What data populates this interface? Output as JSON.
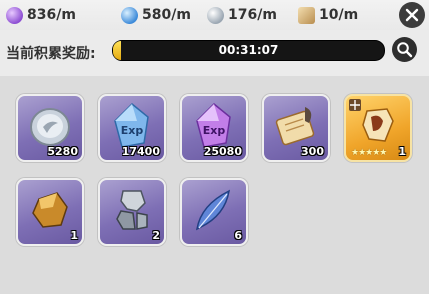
{
  "rates": [
    {
      "icon": "purple-gem-icon",
      "value": "836/m"
    },
    {
      "icon": "blue-crystal-icon",
      "value": "580/m"
    },
    {
      "icon": "silver-coin-icon",
      "value": "176/m"
    },
    {
      "icon": "scroll-icon",
      "value": "10/m"
    }
  ],
  "timer": {
    "label": "当前积累奖励:",
    "time": "00:31:07",
    "progress": 0.03
  },
  "items": [
    {
      "name": "silver-coin",
      "count": "5280"
    },
    {
      "name": "blue-exp-crystal",
      "count": "17400",
      "art_text": "Exp"
    },
    {
      "name": "purple-exp-crystal",
      "count": "25080",
      "art_text": "Exp"
    },
    {
      "name": "scroll-quill",
      "count": "300"
    },
    {
      "name": "hero-shard",
      "count": "1",
      "stars": "★★★★★"
    },
    {
      "name": "amber-stone",
      "count": "1"
    },
    {
      "name": "silver-ore",
      "count": "2"
    },
    {
      "name": "blue-feather",
      "count": "6"
    }
  ],
  "colors": {
    "accent_gold": "#f0a52a",
    "slot_purple": "#7e6fb5"
  }
}
